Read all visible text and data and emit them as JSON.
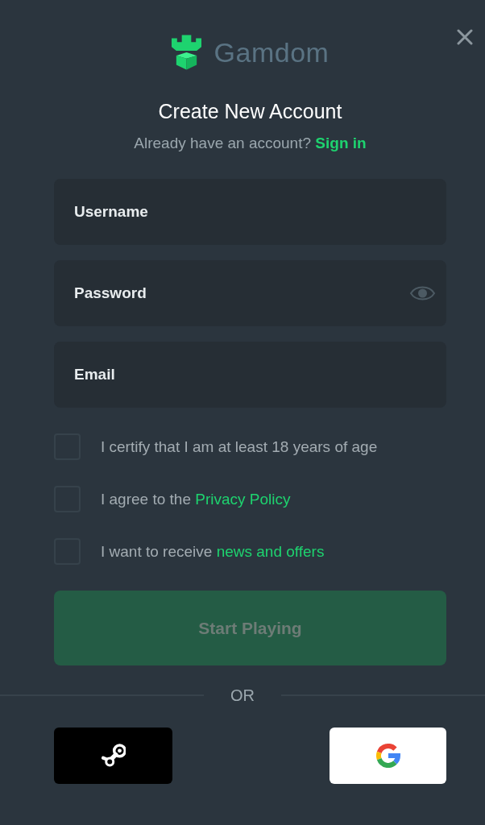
{
  "logo": {
    "text": "Gamdom"
  },
  "title": "Create New Account",
  "subtitle": {
    "text": "Already have an account?",
    "link": "Sign in"
  },
  "fields": [
    {
      "kind": "text",
      "placeholder": "Username"
    },
    {
      "kind": "password",
      "placeholder": "Password"
    },
    {
      "kind": "email",
      "placeholder": "Email"
    }
  ],
  "checkboxes": [
    {
      "text": "I certify that I am at least 18 years of age",
      "checked": false
    },
    {
      "text": "I agree to the",
      "link": "Privacy Policy",
      "checked": false
    },
    {
      "text": "I want to receive",
      "link": "news and offers",
      "checked": false
    }
  ],
  "submit": {
    "label": "Start Playing",
    "disabled": true
  },
  "divider": "OR",
  "social": [
    {
      "kind": "steam"
    },
    {
      "kind": "google"
    }
  ]
}
